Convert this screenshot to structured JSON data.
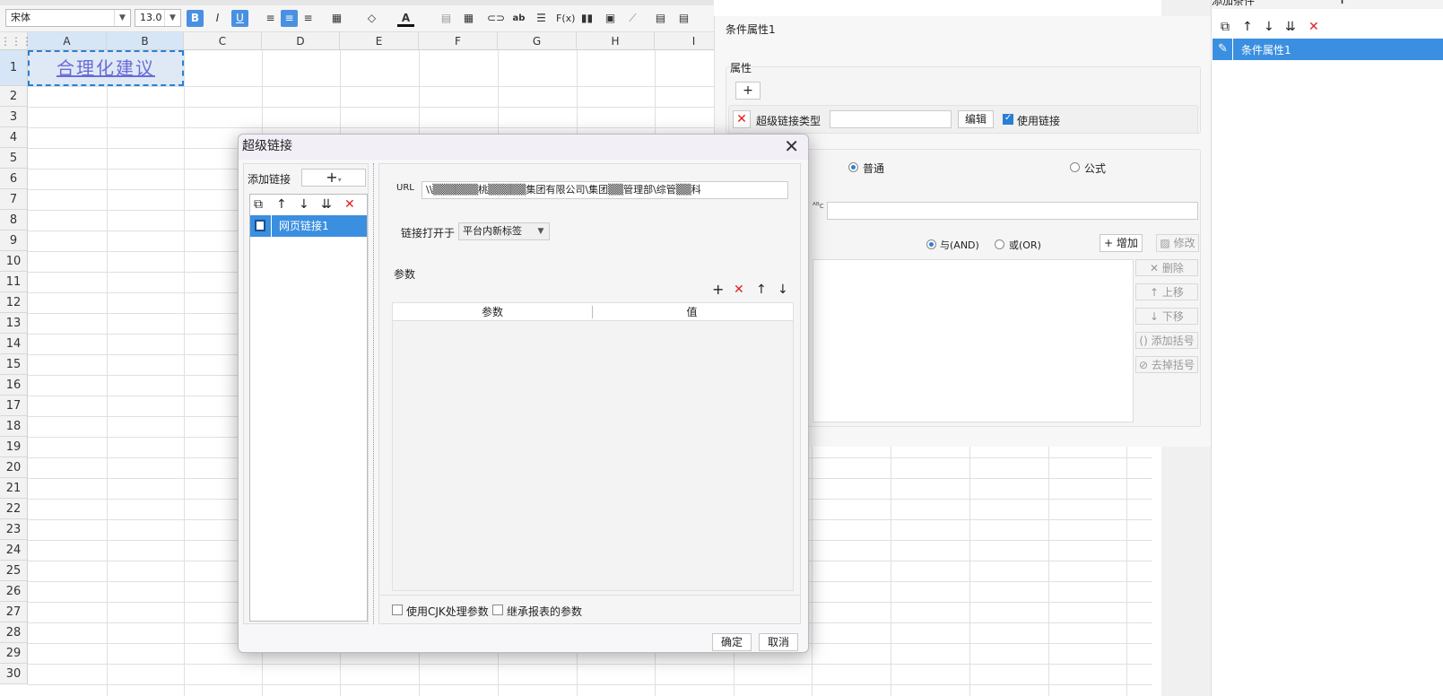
{
  "toolbar": {
    "font": "宋体",
    "size": "13.0",
    "bold": "B",
    "italic": "I",
    "underline": "U"
  },
  "columns": [
    "A",
    "B",
    "C",
    "D",
    "E",
    "F",
    "G",
    "H",
    "I"
  ],
  "rows": [
    "1",
    "2",
    "3",
    "4",
    "5",
    "6",
    "7",
    "8",
    "9",
    "10",
    "11",
    "12",
    "13",
    "14",
    "15",
    "16",
    "17",
    "18",
    "19",
    "20",
    "21",
    "22",
    "23",
    "24",
    "25",
    "26",
    "27",
    "28",
    "29",
    "30"
  ],
  "cell_a1": "合理化建议",
  "condpanel": {
    "title": "条件属性1",
    "attr_label": "属性",
    "add": "+",
    "hyperlink_type": "超级链接类型",
    "edit": "编辑",
    "use_link": "使用链接",
    "normal": "普通",
    "formula": "公式",
    "and": "与(AND)",
    "or": "或(OR)",
    "add_btn": "增加",
    "modify": "修改",
    "delete": "删除",
    "up": "上移",
    "down": "下移",
    "add_bracket": "添加括号",
    "remove_bracket": "去掉括号"
  },
  "farright": {
    "header": "添加条件",
    "item": "条件属性1"
  },
  "dialog": {
    "title": "超级链接",
    "add_link": "添加链接",
    "link_item": "网页链接1",
    "url_label": "URL",
    "url_value": "\\\\▒▒▒▒▒▒桃▒▒▒▒▒集团有限公司\\集团▒▒管理部\\综管▒▒科",
    "open_in_label": "链接打开于",
    "open_in_value": "平台内新标签",
    "params_label": "参数",
    "col_param": "参数",
    "col_value": "值",
    "cjk": "使用CJK处理参数",
    "inherit": "继承报表的参数",
    "ok": "确定",
    "cancel": "取消"
  }
}
